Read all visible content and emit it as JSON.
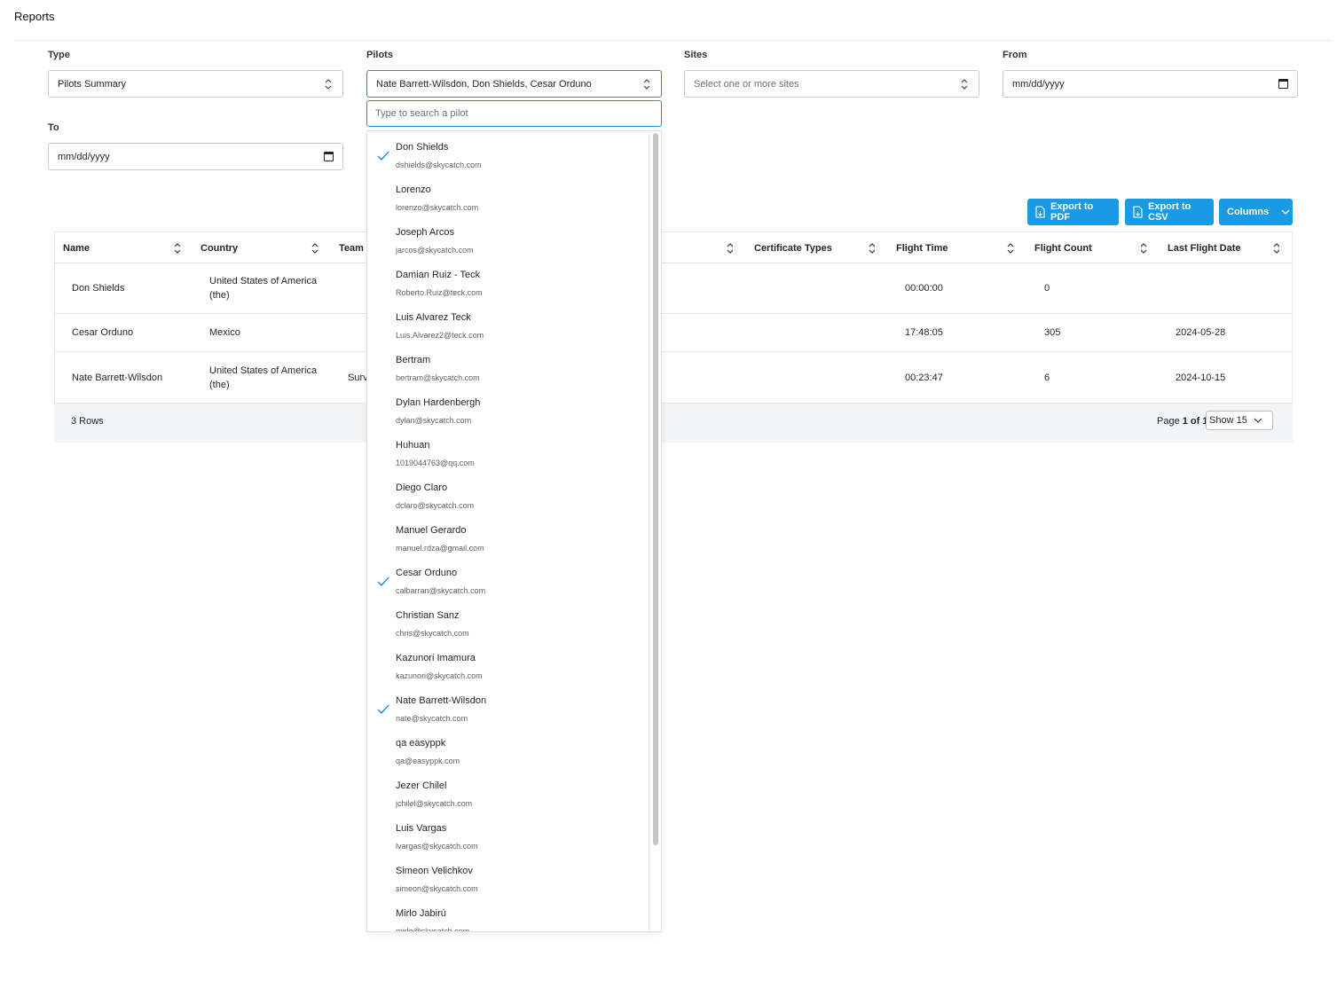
{
  "page": {
    "title": "Reports"
  },
  "filters": {
    "type": {
      "label": "Type",
      "value": "Pilots Summary"
    },
    "pilots": {
      "label": "Pilots",
      "value": "Nate Barrett-Wilsdon, Don Shields, Cesar Orduno",
      "search_placeholder": "Type to search a pilot"
    },
    "sites": {
      "label": "Sites",
      "placeholder": "Select one or more sites"
    },
    "from": {
      "label": "From",
      "value": "mm/dd/yyyy"
    },
    "to": {
      "label": "To",
      "value": "mm/dd/yyyy"
    }
  },
  "toolbar": {
    "export_pdf": "Export to PDF",
    "export_csv": "Export to CSV",
    "columns": "Columns"
  },
  "table": {
    "headers": {
      "name": "Name",
      "country": "Country",
      "team": "Team",
      "certificate_types": "Certificate Types",
      "flight_time": "Flight Time",
      "flight_count": "Flight Count",
      "last_flight_date": "Last Flight Date"
    },
    "rows": [
      {
        "name": "Don Shields",
        "country_l1": "United States of America",
        "country_l2": "(the)",
        "team": "",
        "flight_time": "00:00:00",
        "flight_count": "0",
        "last_flight_date": ""
      },
      {
        "name": "Cesar Orduno",
        "country_l1": "Mexico",
        "country_l2": "",
        "team": "",
        "flight_time": "17:48:05",
        "flight_count": "305",
        "last_flight_date": "2024-05-28"
      },
      {
        "name": "Nate Barrett-Wilsdon",
        "country_l1": "United States of America",
        "country_l2": "(the)",
        "team": "Surv",
        "flight_time": "00:23:47",
        "flight_count": "6",
        "last_flight_date": "2024-10-15"
      }
    ],
    "footer": {
      "rows_count": "3 Rows",
      "page_prefix": "Page ",
      "page_current": "1 of 1",
      "show": "Show 15"
    }
  },
  "pilot_options": [
    {
      "name": "Don Shields",
      "email": "dshields@skycatch.com",
      "selected": true
    },
    {
      "name": "Lorenzo",
      "email": "lorenzo@skycatch.com",
      "selected": false
    },
    {
      "name": "Joseph Arcos",
      "email": "jarcos@skycatch.com",
      "selected": false
    },
    {
      "name": "Damian Ruiz - Teck",
      "email": "Roberto.Ruiz@teck.com",
      "selected": false
    },
    {
      "name": "Luis Alvarez Teck",
      "email": "Luis.Alvarez2@teck.com",
      "selected": false
    },
    {
      "name": "Bertram",
      "email": "bertram@skycatch.com",
      "selected": false
    },
    {
      "name": "Dylan Hardenbergh",
      "email": "dylan@skycatch.com",
      "selected": false
    },
    {
      "name": "Huhuan",
      "email": "1019044763@qq.com",
      "selected": false
    },
    {
      "name": "Diego Claro",
      "email": "dclaro@skycatch.com",
      "selected": false
    },
    {
      "name": "Manuel Gerardo",
      "email": "manuel.rdza@gmail.com",
      "selected": false
    },
    {
      "name": "Cesar Orduno",
      "email": "calbarran@skycatch.com",
      "selected": true
    },
    {
      "name": "Christian Sanz",
      "email": "chris@skycatch.com",
      "selected": false
    },
    {
      "name": "Kazunori Imamura",
      "email": "kazunori@skycatch.com",
      "selected": false
    },
    {
      "name": "Nate Barrett-Wilsdon",
      "email": "nate@skycatch.com",
      "selected": true
    },
    {
      "name": "qa easyppk",
      "email": "qa@easyppk.com",
      "selected": false
    },
    {
      "name": "Jezer Chilel",
      "email": "jchilel@skycatch.com",
      "selected": false
    },
    {
      "name": "Luis Vargas",
      "email": "lvargas@skycatch.com",
      "selected": false
    },
    {
      "name": "Simeon Velichkov",
      "email": "simeon@skycatch.com",
      "selected": false
    },
    {
      "name": "Mirlo Jabirú",
      "email": "mirlo@skycatch.com",
      "selected": false
    }
  ],
  "colors": {
    "accent": "#1a9ae3",
    "check": "#1f8fd6",
    "footer_bg": "#f3f4f5"
  }
}
